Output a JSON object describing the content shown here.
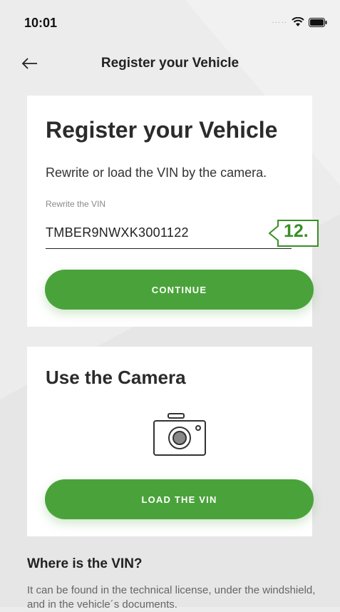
{
  "status": {
    "time": "10:01"
  },
  "nav": {
    "title": "Register your Vehicle"
  },
  "register_card": {
    "title": "Register your Vehicle",
    "description": "Rewrite or load the VIN by the camera.",
    "vin_label": "Rewrite the VIN",
    "vin_value": "TMBER9NWXK3001122",
    "callout": "12.",
    "continue_label": "CONTINUE"
  },
  "camera_card": {
    "title": "Use the Camera",
    "icon": "camera-icon",
    "load_label": "LOAD THE VIN"
  },
  "where": {
    "title": "Where is the VIN?",
    "description": "It can be found in the technical license, under the windshield, and in the vehicle´s documents."
  },
  "colors": {
    "accent": "#4aa33a",
    "background": "#ececec",
    "callout": "#3a8f27"
  }
}
